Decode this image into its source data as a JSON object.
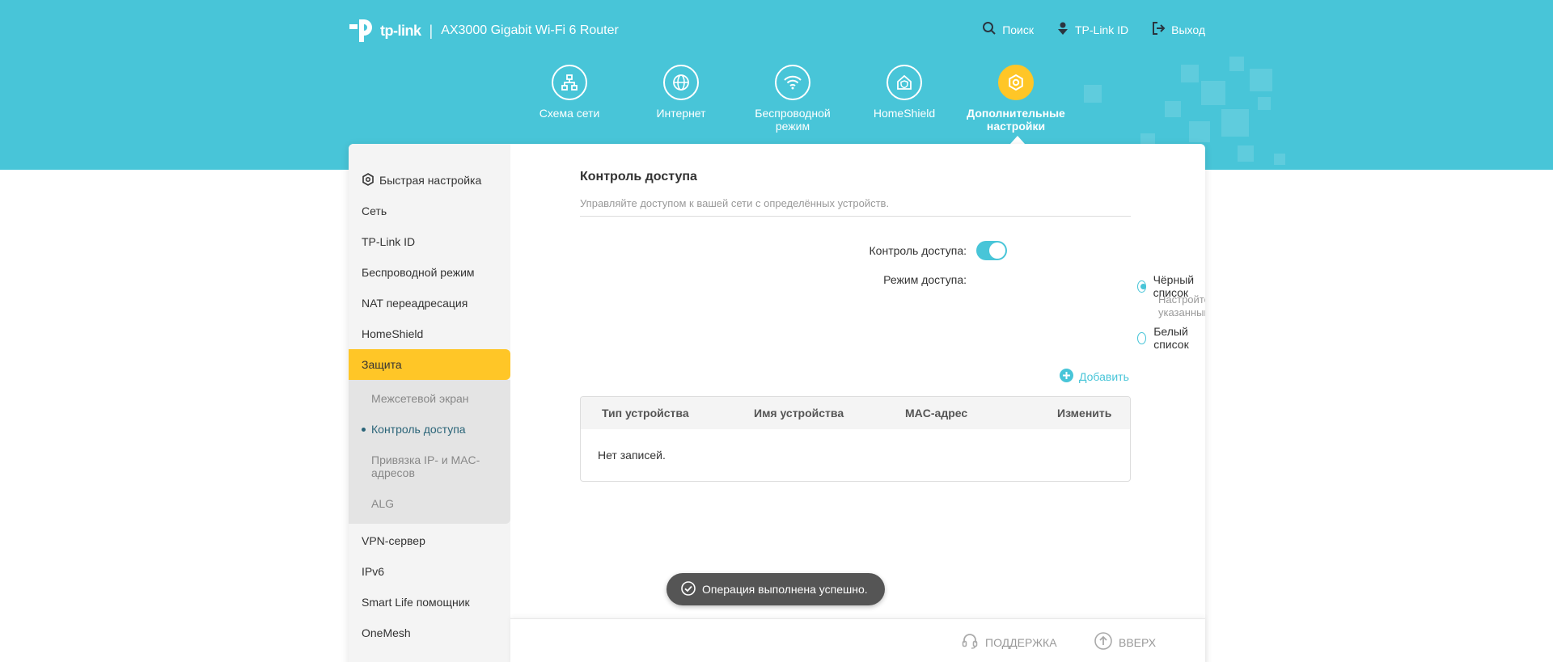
{
  "header": {
    "logo_text": "tp-link",
    "separator": "|",
    "model": "AX3000 Gigabit Wi-Fi 6 Router",
    "links": [
      {
        "icon": "search-icon",
        "label": "Поиск"
      },
      {
        "icon": "tplink-id-icon",
        "label": "TP-Link ID"
      },
      {
        "icon": "logout-icon",
        "label": "Выход"
      }
    ]
  },
  "nav": {
    "items": [
      {
        "icon": "network-map-icon",
        "label": "Схема сети"
      },
      {
        "icon": "internet-globe-icon",
        "label": "Интернет"
      },
      {
        "icon": "wifi-icon",
        "label": "Беспроводной режим"
      },
      {
        "icon": "homeshield-icon",
        "label": "HomeShield"
      },
      {
        "icon": "gear-icon",
        "label": "Дополнительные настройки",
        "active": true
      }
    ]
  },
  "sidebar": {
    "items": [
      {
        "label": "Быстрая настройка",
        "icon": "quick-setup-gear-icon"
      },
      {
        "label": "Сеть"
      },
      {
        "label": "TP-Link ID"
      },
      {
        "label": "Беспроводной режим"
      },
      {
        "label": "NAT переадресация"
      },
      {
        "label": "HomeShield"
      },
      {
        "label": "Защита",
        "active": true
      },
      {
        "label": "VPN-сервер"
      },
      {
        "label": "IPv6"
      },
      {
        "label": "Smart Life помощник"
      },
      {
        "label": "OneMesh"
      }
    ],
    "submenu": [
      {
        "label": "Межсетевой экран"
      },
      {
        "label": "Контроль доступа",
        "active": true
      },
      {
        "label": "Привязка IP- и MAC-адресов"
      },
      {
        "label": "ALG"
      }
    ]
  },
  "content": {
    "title": "Контроль доступа",
    "description": "Управляйте доступом к вашей сети с определённых устройств.",
    "access_control_label": "Контроль доступа:",
    "access_control_on": true,
    "access_mode_label": "Режим доступа:",
    "modes": [
      {
        "label": "Чёрный список",
        "checked": true,
        "hint": "Настройте черный список, чтобы блокировать доступ указанным устройствам к вашей сети."
      },
      {
        "label": "Белый список",
        "checked": false
      }
    ],
    "add_label": "Добавить",
    "table": {
      "columns": [
        "Тип устройства",
        "Имя устройства",
        "MAC-адрес",
        "Изменить"
      ],
      "empty_text": "Нет записей."
    }
  },
  "toast": {
    "text": "Операция выполнена успешно.",
    "icon": "check-circle-icon"
  },
  "footer": {
    "support_label": "ПОДДЕРЖКА",
    "top_label": "ВВЕРХ"
  },
  "colors": {
    "accent": "#48c5d8",
    "active": "#ffc627",
    "toast": "#555555"
  }
}
